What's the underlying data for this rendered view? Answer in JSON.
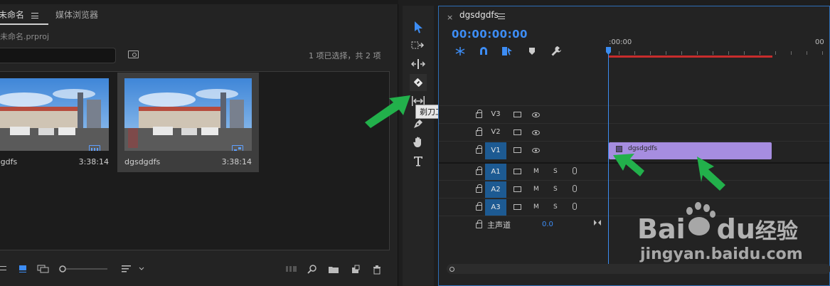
{
  "project_panel": {
    "tab_active": "未命名",
    "tab_inactive": "媒体浏览器",
    "project_file": "未命名.prproj",
    "selection_status": "1 项已选择，共 2 项",
    "items": [
      {
        "name": "dgsdgdfs",
        "duration": "3:38:14",
        "badge": "film-icon"
      },
      {
        "name": "dgsdgdfs",
        "duration": "3:38:14",
        "badge": "sequence-icon"
      }
    ]
  },
  "tools": {
    "tooltip": "剃刀工具 (C)",
    "items": [
      "selection-tool",
      "track-select-tool",
      "ripple-edit-tool",
      "razor-tool",
      "slip-tool",
      "pen-tool",
      "hand-tool",
      "type-tool"
    ]
  },
  "timeline": {
    "title": "dgsdgdfs",
    "timecode": "00:00:00:00",
    "ruler_start": ":00:00",
    "ruler_end": "00",
    "tracks_video": [
      "V3",
      "V2",
      "V1"
    ],
    "tracks_audio": [
      "A1",
      "A2",
      "A3"
    ],
    "mute_label": "M",
    "solo_label": "S",
    "master_label": "主声道",
    "master_value": "0.0",
    "clip_name": "dgsdgdfs"
  },
  "watermark": {
    "logo": "Bai",
    "logo2": "du",
    "logo_cn": "经验",
    "url": "jingyan.baidu.com"
  },
  "colors": {
    "accent_blue": "#3d8df5",
    "clip_purple": "#a68de0",
    "workarea_red": "#c72c2c",
    "arrow_green": "#22b04b"
  }
}
